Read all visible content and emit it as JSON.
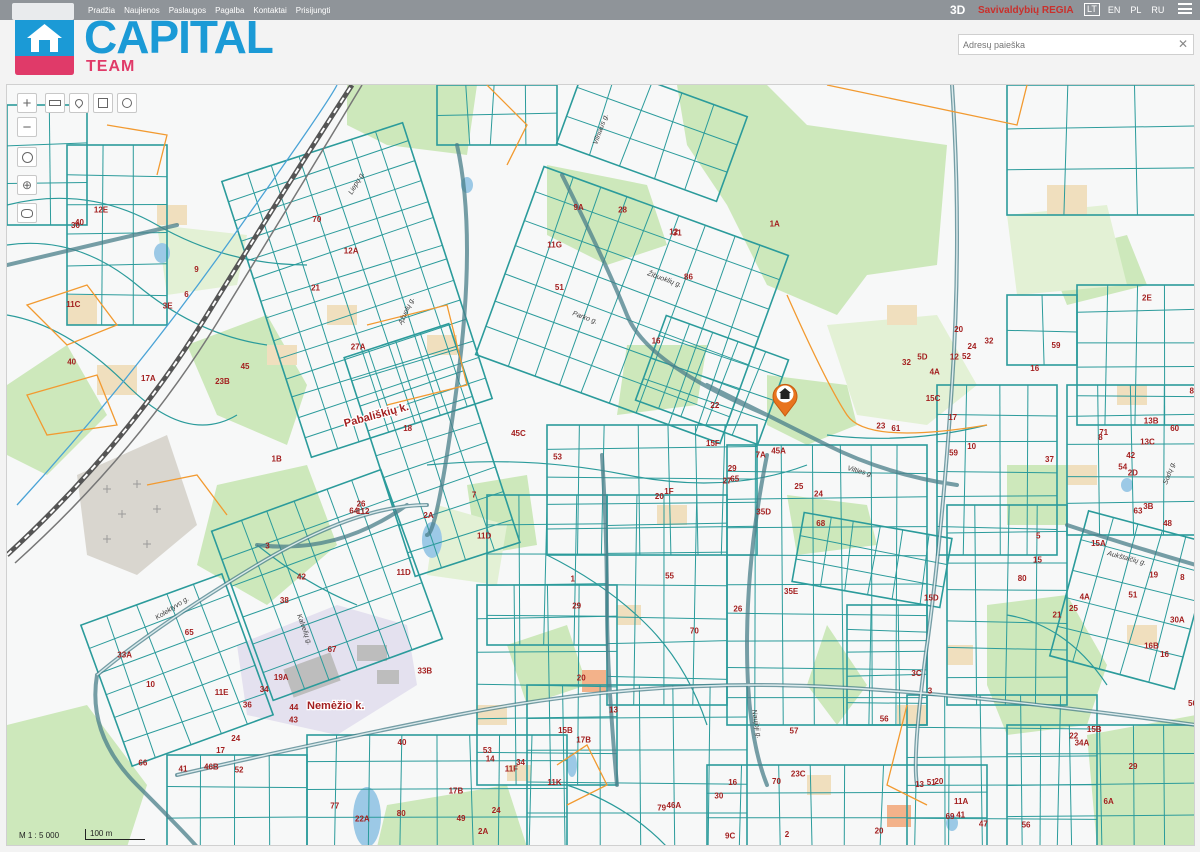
{
  "topbar": {
    "nav": [
      "Pradžia",
      "Naujienos",
      "Paslaugos",
      "Pagalba",
      "Kontaktai",
      "Prisijungti"
    ],
    "brand_3d": "3D",
    "brand_regia": "Savivaldybių REGIA",
    "languages": [
      "LT",
      "EN",
      "PL",
      "RU"
    ],
    "active_language": "LT"
  },
  "logo": {
    "capital": "CAPITAL",
    "team": "TEAM"
  },
  "search": {
    "placeholder": "Adresų paieška",
    "value": ""
  },
  "map": {
    "scale_label": "M 1 : 5 000",
    "scale_bar_label": "100 m",
    "place_labels": [
      "Pabališkių k.",
      "Nemėžio k."
    ],
    "street_labels": [
      "Kolektyvo g.",
      "Liepų g.",
      "Ąžuolų g.",
      "Vilniaus g.",
      "Parko g.",
      "Žibuoklių g.",
      "Kalvelių g.",
      "Vilties g.",
      "Aukštaičių g.",
      "Sodų g.",
      "Naujoji g."
    ],
    "parcel_labels": [
      "45",
      "70",
      "86",
      "65",
      "68",
      "80",
      "82",
      "42",
      "52",
      "70",
      "80",
      "20",
      "22",
      "16",
      "10",
      "6",
      "1B",
      "1A",
      "20",
      "24",
      "16",
      "8",
      "3",
      "10",
      "29",
      "14",
      "16",
      "20",
      "25",
      "23",
      "23B",
      "27A",
      "31",
      "35D",
      "35E",
      "20",
      "19",
      "19A",
      "17",
      "17B",
      "49",
      "47",
      "56",
      "16B",
      "32",
      "11C",
      "11D",
      "9A",
      "29",
      "56",
      "52",
      "60",
      "34",
      "24",
      "13",
      "53",
      "51",
      "69",
      "63",
      "61",
      "30",
      "26",
      "16",
      "27",
      "25",
      "24",
      "54",
      "64",
      "66",
      "20",
      "2A",
      "70",
      "56",
      "48",
      "5D",
      "3E",
      "112",
      "11G",
      "1F",
      "3C",
      "3B",
      "4A",
      "44",
      "46B",
      "46A",
      "22A",
      "30",
      "34A",
      "30A",
      "32",
      "40",
      "18",
      "22",
      "15F",
      "15D",
      "13B",
      "13C",
      "11D",
      "11E",
      "11F",
      "11K",
      "11A",
      "15B",
      "15A",
      "15C",
      "17A",
      "2A",
      "45C",
      "45A",
      "7A",
      "2E",
      "2D",
      "33B",
      "33A",
      "15B",
      "17B",
      "23C",
      "29",
      "21",
      "17",
      "12E",
      "12A",
      "12",
      "53",
      "57",
      "59",
      "51",
      "43",
      "41",
      "26",
      "24",
      "9C",
      "6A",
      "8",
      "4A",
      "40",
      "21",
      "51",
      "55",
      "59",
      "37",
      "71",
      "67",
      "65",
      "79",
      "77",
      "41",
      "13",
      "15",
      "12",
      "9",
      "7",
      "28",
      "1",
      "3",
      "5",
      "42",
      "38",
      "36",
      "34",
      "40",
      "2"
    ],
    "poi_names": [
      "house-marker-icon"
    ],
    "colors": {
      "parcel": "#2b9b9b",
      "road": "#4a7f8a",
      "railway": "#555555",
      "label": "#a31f1f",
      "forest": "#c6e3b2",
      "building": "#f0e0c0",
      "water": "#9cc9e6",
      "marker": "#e8741e"
    }
  }
}
